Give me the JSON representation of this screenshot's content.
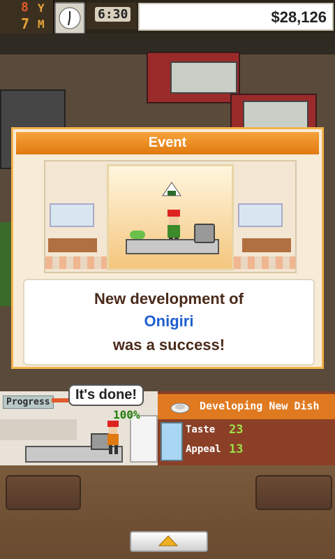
{
  "status_bar": {
    "year_value": "8",
    "year_unit": "Y",
    "month_value": "7",
    "month_unit": "M",
    "time": "6:30",
    "money": "$28,126"
  },
  "event_dialog": {
    "title": "Event",
    "message_line1": "New development of",
    "dish_name": "Onigiri",
    "message_line3": "was a success!"
  },
  "progress_panel": {
    "label": "Progress",
    "bubble_text": "It's done!",
    "percent": "100%"
  },
  "dev_panel": {
    "title": "Developing New Dish",
    "stats": [
      {
        "label": "Taste",
        "value": "23"
      },
      {
        "label": "Appeal",
        "value": "13"
      }
    ]
  },
  "colors": {
    "accent_orange": "#e07a10",
    "dish_name_blue": "#1e5fd0",
    "stat_green": "#9ee04a"
  },
  "icons": [
    "clock-icon",
    "rice-ball-icon",
    "plate-icon",
    "up-arrow-icon"
  ]
}
